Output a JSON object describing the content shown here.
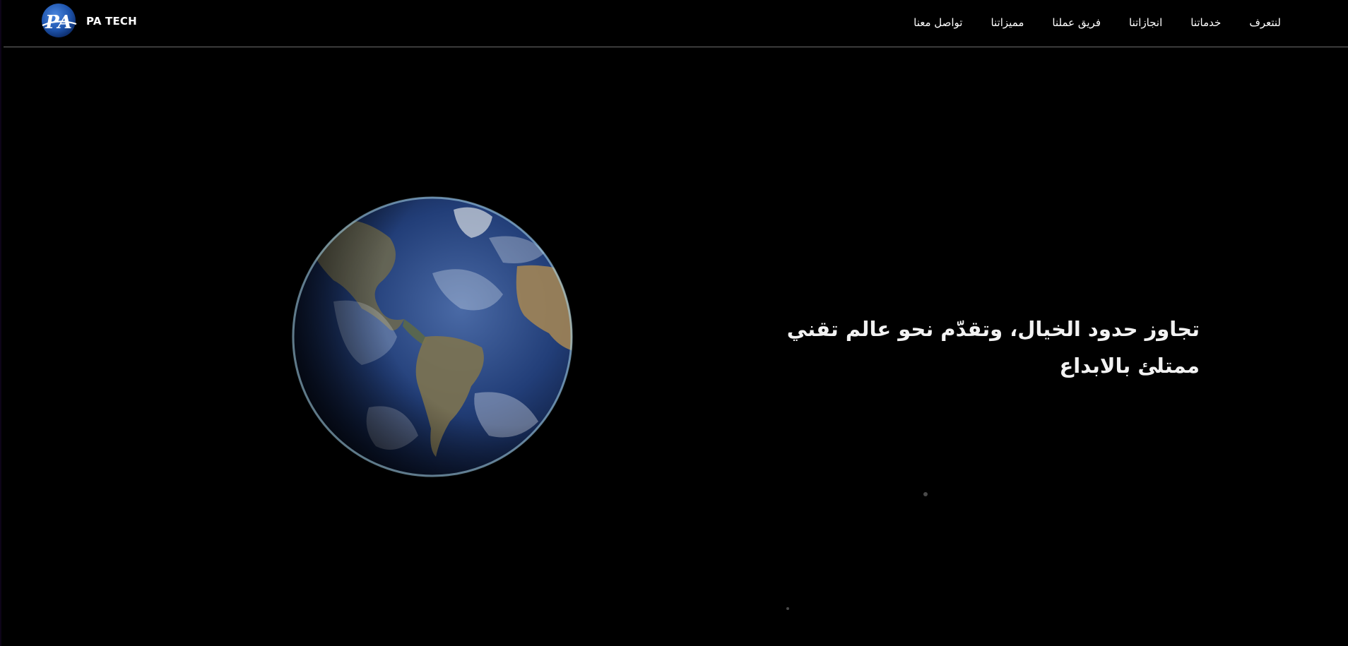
{
  "header": {
    "logo_text": "PA",
    "brand_name": "PA TECH",
    "menu": [
      {
        "label": "لنتعرف"
      },
      {
        "label": "خدماتنا"
      },
      {
        "label": "انجازاتنا"
      },
      {
        "label": "فريق عملنا"
      },
      {
        "label": "مميزاتنا"
      },
      {
        "label": "تواصل معنا"
      }
    ]
  },
  "hero": {
    "heading_line1": "تجاوز حدود الخيال، وتقدّم نحو عالم تقني",
    "heading_line2": "ممتلئ بالابداع",
    "image": "earth-globe"
  },
  "colors": {
    "background": "#000000",
    "text": "#ffffff",
    "divider": "#6e6e6e",
    "logo_blue": "#1f56b0"
  }
}
